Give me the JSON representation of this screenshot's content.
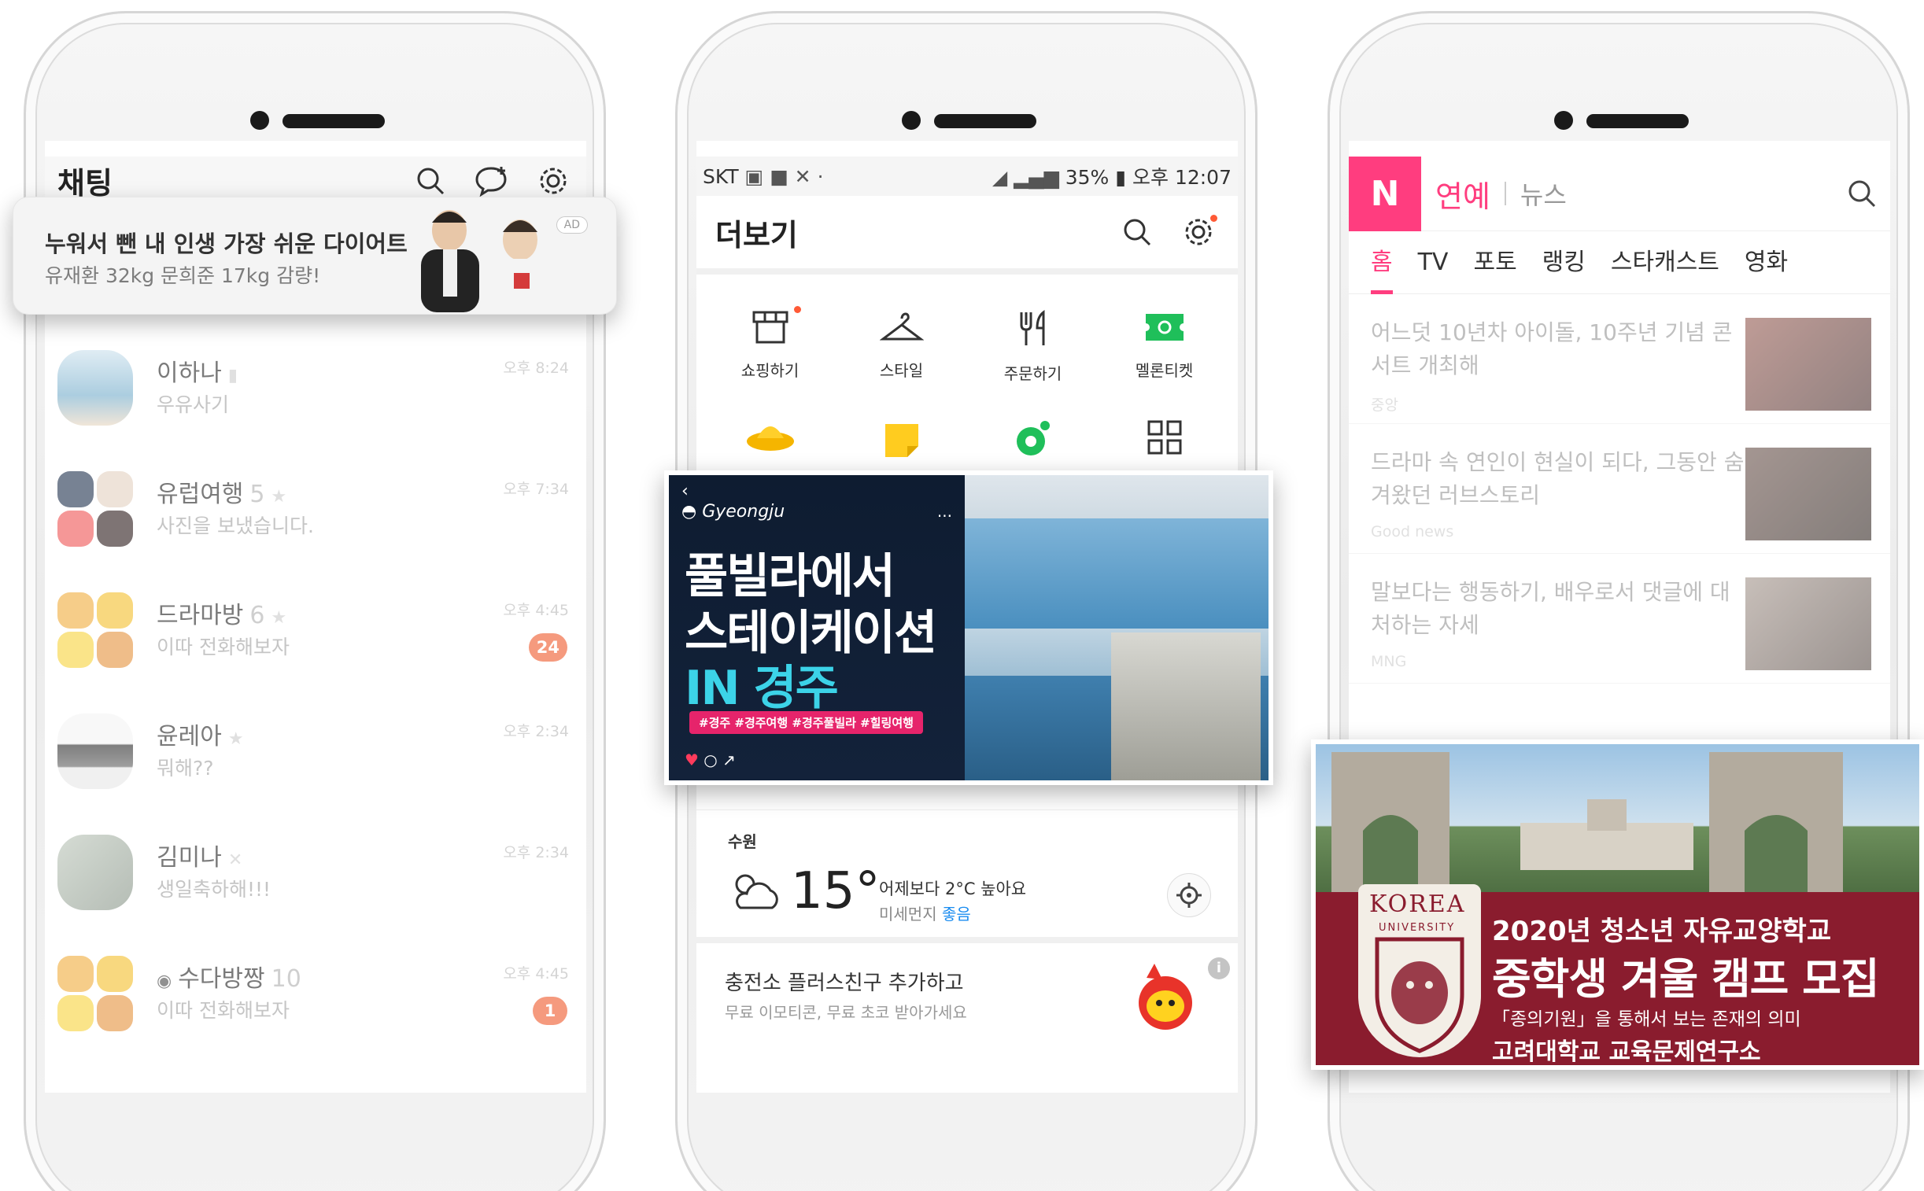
{
  "phone1": {
    "title": "채팅",
    "ad": {
      "title": "누워서 뺀 내 인생 가장 쉬운 다이어트",
      "subtitle": "유재환 32kg 문희준 17kg 감량!",
      "tag": "AD"
    },
    "chats": [
      {
        "name": "이하나",
        "count": "",
        "message": "우유사기",
        "time": "오후 8:24",
        "badge": ""
      },
      {
        "name": "유럽여행",
        "count": "5",
        "message": "사진을 보냈습니다.",
        "time": "오후 7:34",
        "badge": ""
      },
      {
        "name": "드라마방",
        "count": "6",
        "message": "이따 전화해보자",
        "time": "오후 4:45",
        "badge": "24"
      },
      {
        "name": "윤레아",
        "count": "",
        "message": "뭐해??",
        "time": "오후 2:34",
        "badge": ""
      },
      {
        "name": "김미나",
        "count": "",
        "message": "생일축하해!!!",
        "time": "오후 2:34",
        "badge": ""
      },
      {
        "name": "수다방짱",
        "count": "10",
        "message": "이따 전화해보자",
        "time": "오후 4:45",
        "badge": "1"
      }
    ]
  },
  "phone2": {
    "status": {
      "carrier": "SKT",
      "battery": "35%",
      "time": "오후 12:07"
    },
    "title": "더보기",
    "grid": [
      {
        "label": "쇼핑하기",
        "icon": "shop-icon"
      },
      {
        "label": "스타일",
        "icon": "hanger-icon"
      },
      {
        "label": "주문하기",
        "icon": "fork-icon"
      },
      {
        "label": "멜론티켓",
        "icon": "ticket-icon"
      }
    ],
    "banner": {
      "brand": "Gyeongju",
      "line1": "풀빌라에서",
      "line2": "스테이케이션",
      "line3": "IN 경주",
      "tags": "#경주 #경주여행 #경주풀빌라 #힐링여행"
    },
    "weather": {
      "city": "수원",
      "temp": "15°",
      "desc": "어제보다 2°C 높아요",
      "dust_label": "미세먼지",
      "dust_value": "좋음"
    },
    "promo": {
      "title": "충전소 플러스친구 추가하고",
      "subtitle": "무료 이모티콘, 무료 초코 받아가세요"
    }
  },
  "phone3": {
    "logo": "N",
    "section": "연예",
    "section2": "뉴스",
    "tabs": [
      "홈",
      "TV",
      "포토",
      "랭킹",
      "스타캐스트",
      "영화"
    ],
    "news": [
      {
        "headline": "어느덧 10년차 아이돌, 10주년 기념 콘서트 개최해",
        "source": "중앙"
      },
      {
        "headline": "드라마 속 연인이 현실이 되다, 그동안 숨겨왔던 러브스토리",
        "source": "Good news"
      },
      {
        "headline": "말보다는 행동하기, 배우로서 댓글에 대처하는 자세",
        "source": "MNG"
      }
    ],
    "ad": {
      "university": "KOREA",
      "univ_sub": "UNIVERSITY",
      "line1": "2020년 청소년 자유교양학교",
      "line2": "중학생 겨울 캠프 모집",
      "line3": "「종의기원」을 통해서 보는 존재의 의미",
      "line4": "고려대학교 교육문제연구소"
    }
  },
  "colors": {
    "kakao_badge": "#f0643a",
    "naver_pink": "#ff3d7f",
    "banner_navy": "#0e1c31",
    "korea_crimson": "#8a1c2e"
  }
}
